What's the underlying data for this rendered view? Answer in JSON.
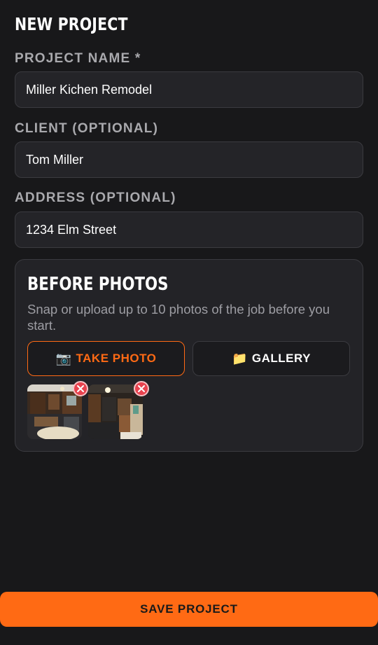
{
  "page": {
    "title": "NEW PROJECT"
  },
  "fields": {
    "project_name": {
      "label": "PROJECT NAME *",
      "value": "Miller Kichen Remodel"
    },
    "client": {
      "label": "CLIENT (OPTIONAL)",
      "value": "Tom Miller"
    },
    "address": {
      "label": "ADDRESS (OPTIONAL)",
      "value": "1234 Elm Street"
    }
  },
  "before_photos": {
    "title": "BEFORE PHOTOS",
    "description": "Snap or upload up to 10 photos of the job before you start.",
    "take_photo": {
      "icon": "camera-icon",
      "glyph": "📷",
      "label": "TAKE PHOTO"
    },
    "gallery": {
      "icon": "folder-icon",
      "glyph": "📁",
      "label": "GALLERY"
    },
    "photos": [
      {
        "remove_icon": "close-circle-icon"
      },
      {
        "remove_icon": "close-circle-icon"
      }
    ]
  },
  "save_button": {
    "label": "SAVE PROJECT"
  },
  "colors": {
    "background": "#18181a",
    "accent": "#ff6a14",
    "remove": "#e8434f"
  }
}
